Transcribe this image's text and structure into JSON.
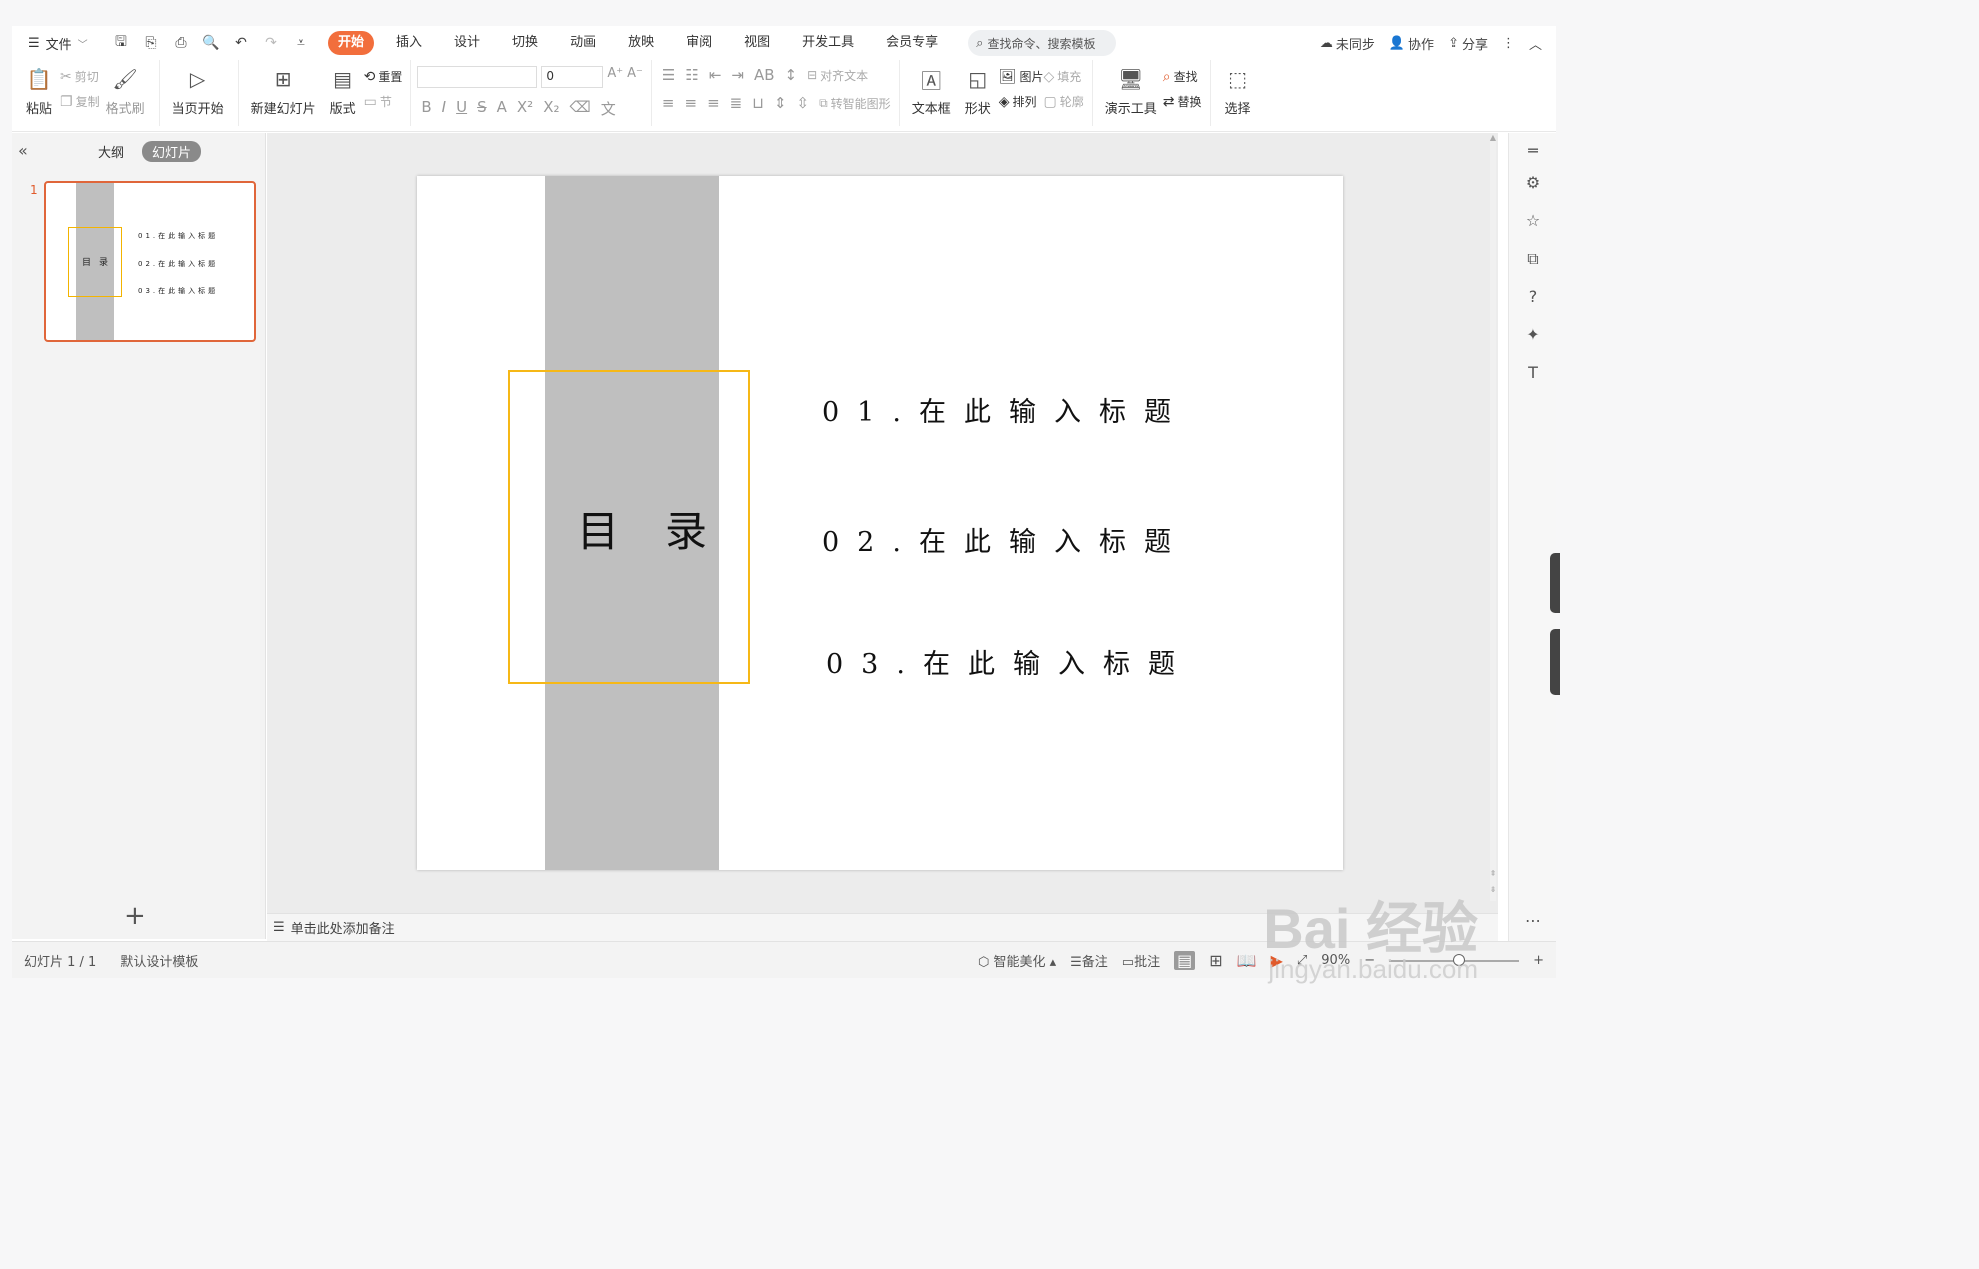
{
  "menubar": {
    "file": "文件",
    "tabs": [
      "开始",
      "插入",
      "设计",
      "切换",
      "动画",
      "放映",
      "审阅",
      "视图",
      "开发工具",
      "会员专享"
    ],
    "search_placeholder": "查找命令、搜索模板",
    "right": {
      "sync": "未同步",
      "collab": "协作",
      "share": "分享"
    }
  },
  "ribbon": {
    "paste": "粘贴",
    "cut": "剪切",
    "copy": "复制",
    "format_painter": "格式刷",
    "from_current": "当页开始",
    "new_slide": "新建幻灯片",
    "layout": "版式",
    "reset": "重置",
    "section": "节",
    "font_size": "0",
    "align_text": "对齐文本",
    "smartart": "转智能图形",
    "textbox": "文本框",
    "shape": "形状",
    "picture": "图片",
    "arrange": "排列",
    "fill": "填充",
    "outline": "轮廓",
    "presentation_tools": "演示工具",
    "find": "查找",
    "replace": "替换",
    "select": "选择"
  },
  "left_panel": {
    "tab_outline": "大纲",
    "tab_slides": "幻灯片",
    "slide_number": "1",
    "add_icon": "+"
  },
  "slide": {
    "title": "目录",
    "items": [
      "01.在此输入标题",
      "02.在此输入标题",
      "03.在此输入标题"
    ],
    "band_color": "#bfbfbf",
    "frame_color": "#f6b817"
  },
  "notes": {
    "placeholder": "单击此处添加备注"
  },
  "status": {
    "slide_count": "幻灯片 1 / 1",
    "template": "默认设计模板",
    "beautify": "智能美化",
    "notes": "备注",
    "comments": "批注",
    "zoom": "90%"
  },
  "watermark": {
    "brand": "Bai 经验",
    "url": "jingyan.baidu.com"
  }
}
